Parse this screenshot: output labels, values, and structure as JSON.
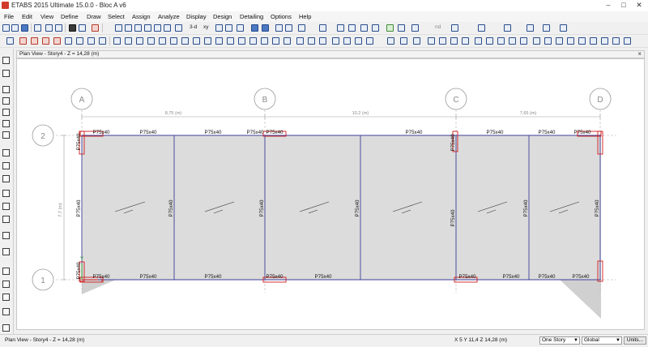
{
  "window": {
    "title": "ETABS 2015 Ultimate 15.0.0 - Bloc A v6",
    "minimize": "–",
    "maximize": "□",
    "close": "✕"
  },
  "menu": [
    "File",
    "Edit",
    "View",
    "Define",
    "Draw",
    "Select",
    "Assign",
    "Analyze",
    "Display",
    "Design",
    "Detailing",
    "Options",
    "Help"
  ],
  "toolbar": {
    "view_3d_label": "3-d",
    "view_xy_label": "xy",
    "view_nd_label": "nd"
  },
  "view": {
    "title": "Plan View - Story4 - Z = 14,28 (m)",
    "close": "×"
  },
  "plan": {
    "grid_columns": [
      "A",
      "B",
      "C",
      "D"
    ],
    "grid_rows": [
      "2",
      "1"
    ],
    "spacing_labels": [
      "8,75 (m)",
      "10,2 (m)",
      "7,65 (m)"
    ],
    "row_spacing_label": "7,7 (m)",
    "beam_label": "P75x40",
    "axis_x": "X",
    "axis_y": "Y"
  },
  "status": {
    "view_text": "Plan View - Story4 - Z = 14,28 (m)",
    "coords": "X 5  Y 11,4  Z 14,28 (m)",
    "story_option": "One Story",
    "coord_system": "Global",
    "units_button": "Units..."
  },
  "colors": {
    "beam": "#3b3f9a",
    "slab_fill": "#dcdcdc",
    "column": "#d01c1c",
    "grid_line": "#b4b4b4",
    "bubble": "#9a9a9a"
  }
}
